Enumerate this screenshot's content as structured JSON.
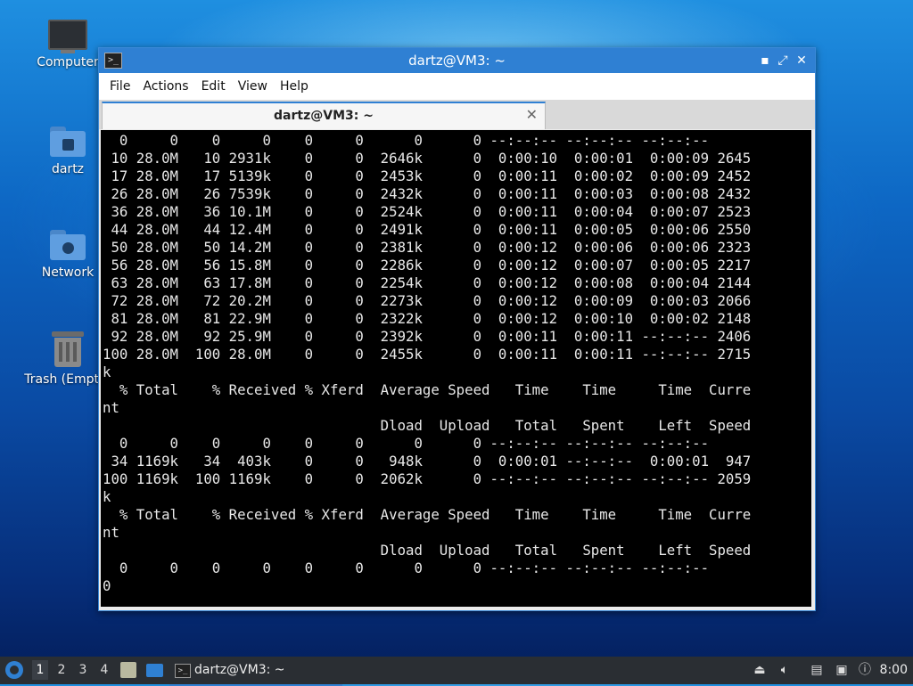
{
  "desktop": {
    "icons": [
      {
        "label": "Computer"
      },
      {
        "label": "dartz"
      },
      {
        "label": "Network"
      },
      {
        "label": "Trash (Empty)"
      }
    ]
  },
  "window": {
    "title": "dartz@VM3: ~",
    "menu": [
      "File",
      "Actions",
      "Edit",
      "View",
      "Help"
    ],
    "tab_title": "dartz@VM3: ~",
    "controls": {
      "minimize": "▪",
      "maximize": "⤢",
      "close": "✕"
    }
  },
  "terminal": {
    "lines": [
      "  0     0    0     0    0     0      0      0 --:--:-- --:--:-- --:--:--",
      " 10 28.0M   10 2931k    0     0  2646k      0  0:00:10  0:00:01  0:00:09 2645",
      " 17 28.0M   17 5139k    0     0  2453k      0  0:00:11  0:00:02  0:00:09 2452",
      " 26 28.0M   26 7539k    0     0  2432k      0  0:00:11  0:00:03  0:00:08 2432",
      " 36 28.0M   36 10.1M    0     0  2524k      0  0:00:11  0:00:04  0:00:07 2523",
      " 44 28.0M   44 12.4M    0     0  2491k      0  0:00:11  0:00:05  0:00:06 2550",
      " 50 28.0M   50 14.2M    0     0  2381k      0  0:00:12  0:00:06  0:00:06 2323",
      " 56 28.0M   56 15.8M    0     0  2286k      0  0:00:12  0:00:07  0:00:05 2217",
      " 63 28.0M   63 17.8M    0     0  2254k      0  0:00:12  0:00:08  0:00:04 2144",
      " 72 28.0M   72 20.2M    0     0  2273k      0  0:00:12  0:00:09  0:00:03 2066",
      " 81 28.0M   81 22.9M    0     0  2322k      0  0:00:12  0:00:10  0:00:02 2148",
      " 92 28.0M   92 25.9M    0     0  2392k      0  0:00:11  0:00:11 --:--:-- 2406",
      "100 28.0M  100 28.0M    0     0  2455k      0  0:00:11  0:00:11 --:--:-- 2715",
      "k",
      "  % Total    % Received % Xferd  Average Speed   Time    Time     Time  Curre",
      "nt",
      "                                 Dload  Upload   Total   Spent    Left  Speed",
      "  0     0    0     0    0     0      0      0 --:--:-- --:--:-- --:--:--",
      " 34 1169k   34  403k    0     0   948k      0  0:00:01 --:--:--  0:00:01  947",
      "100 1169k  100 1169k    0     0  2062k      0 --:--:-- --:--:-- --:--:-- 2059",
      "k",
      "  % Total    % Received % Xferd  Average Speed   Time    Time     Time  Curre",
      "nt",
      "                                 Dload  Upload   Total   Spent    Left  Speed",
      "  0     0    0     0    0     0      0      0 --:--:-- --:--:-- --:--:--",
      "0"
    ]
  },
  "taskbar": {
    "workspaces": [
      "1",
      "2",
      "3",
      "4"
    ],
    "task_label": "dartz@VM3: ~",
    "clock": "8:00",
    "tray_icons": [
      "eject-icon",
      "volume-icon",
      "clipboard-icon",
      "network-icon",
      "update-notifier-icon"
    ]
  },
  "colors": {
    "accent": "#2f80d3",
    "terminal_bg": "#000000",
    "terminal_fg": "#e8e8e8",
    "taskbar_bg": "#2a2e33"
  }
}
